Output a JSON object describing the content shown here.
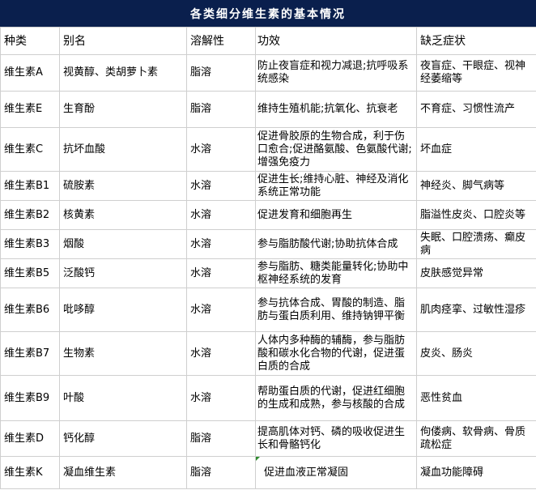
{
  "title": "各类细分维生素的基本情况",
  "headers": [
    "种类",
    "别名",
    "溶解性",
    "功效",
    "缺乏症状"
  ],
  "rows": [
    [
      "维生素A",
      "视黄醇、类胡萝卜素",
      "脂溶",
      "防止夜盲症和视力减退;抗呼吸系统感染",
      "夜盲症、干眼症、视神经萎缩等"
    ],
    [
      "维生素E",
      "生育酚",
      "脂溶",
      "维持生殖机能;抗氧化、抗衰老",
      "不育症、习惯性流产"
    ],
    [
      "维生素C",
      "抗坏血酸",
      "水溶",
      "促进骨胶原的生物合成，利于伤口愈合;促进酪氨酸、色氨酸代谢;增强免疫力",
      "坏血症"
    ],
    [
      "维生素B1",
      "硫胺素",
      "水溶",
      "促进生长;维持心脏、神经及消化系统正常功能",
      "神经炎、脚气病等"
    ],
    [
      "维生素B2",
      "核黄素",
      "水溶",
      "促进发育和细胞再生",
      "脂溢性皮炎、口腔炎等"
    ],
    [
      "维生素B3",
      "烟酸",
      "水溶",
      "参与脂肪酸代谢;协助抗体合成",
      "失眠、口腔溃疡、癫皮病"
    ],
    [
      "维生素B5",
      "泛酸钙",
      "水溶",
      "参与脂肪、糖类能量转化;协助中枢神经系统的发育",
      "皮肤感觉异常"
    ],
    [
      "维生素B6",
      "吡哆醇",
      "水溶",
      "参与抗体合成、胃酸的制造、脂肪与蛋白质利用、维持钠钾平衡",
      "肌肉痉挛、过敏性湿疹"
    ],
    [
      "维生素B7",
      "生物素",
      "水溶",
      "人体内多种酶的辅酶，参与脂肪酸和碳水化合物的代谢，促进蛋白质的合成",
      "皮炎、肠炎"
    ],
    [
      "维生素B9",
      "叶酸",
      "水溶",
      "帮助蛋白质的代谢，促进红细胞的生成和成熟，参与核酸的合成",
      "恶性贫血"
    ],
    [
      "维生素D",
      "钙化醇",
      "脂溶",
      "提高肌体对钙、磷的吸收促进生长和骨骼钙化",
      "佝偻病、软骨病、骨质疏松症"
    ],
    [
      "维生素K",
      "凝血维生素",
      "脂溶",
      "促进血液正常凝固",
      "凝血功能障碍"
    ]
  ]
}
